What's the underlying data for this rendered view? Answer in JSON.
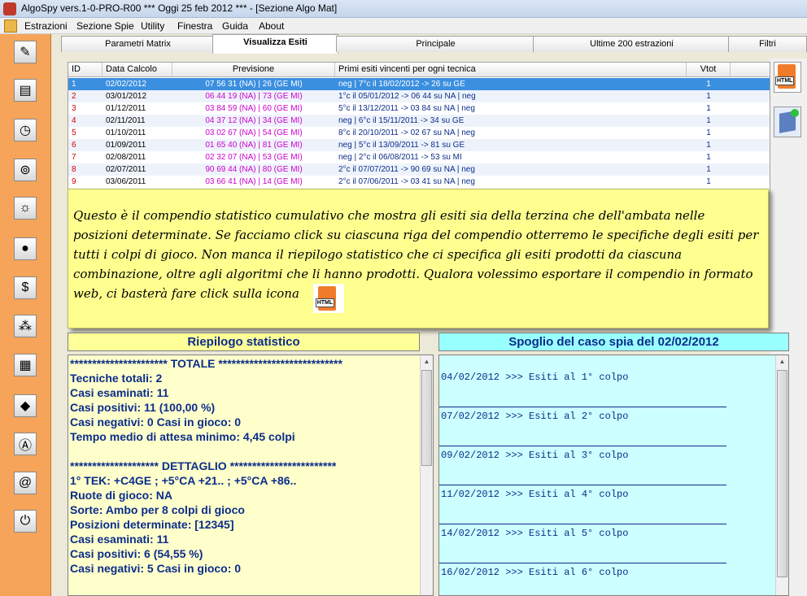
{
  "window": {
    "title": "AlgoSpy vers.1-0-PRO-R00  ***  Oggi 25 feb 2012  ***   - [Sezione Algo Mat]"
  },
  "menu": [
    "Estrazioni",
    "Sezione Spie",
    "Utility",
    "Finestra",
    "Guida",
    "About"
  ],
  "tabs": [
    "Parametri Matrix",
    "Visualizza Esiti",
    "Principale",
    "Ultime 200 estrazioni",
    "Filtri"
  ],
  "grid": {
    "headers": [
      "ID",
      "Data Calcolo",
      "Previsione",
      "Primi esiti vincenti per ogni tecnica",
      "Vtot"
    ],
    "rows": [
      {
        "id": "1",
        "data": "02/02/2012",
        "prev": "07 56 31 (NA) | 26 (GE MI)",
        "esiti": "neg | 7°c il 18/02/2012 -> 26 su GE",
        "vtot": "1"
      },
      {
        "id": "2",
        "data": "03/01/2012",
        "prev": "06 44 19 (NA) | 73 (GE MI)",
        "esiti": "1°c il 05/01/2012 -> 06 44 su NA | neg",
        "vtot": "1"
      },
      {
        "id": "3",
        "data": "01/12/2011",
        "prev": "03 84 59 (NA) | 60 (GE MI)",
        "esiti": "5°c il 13/12/2011 -> 03 84 su NA | neg",
        "vtot": "1"
      },
      {
        "id": "4",
        "data": "02/11/2011",
        "prev": "04 37 12 (NA) | 34 (GE MI)",
        "esiti": "neg | 6°c il 15/11/2011 -> 34 su GE",
        "vtot": "1"
      },
      {
        "id": "5",
        "data": "01/10/2011",
        "prev": "03 02 67 (NA) | 54 (GE MI)",
        "esiti": "8°c il 20/10/2011 -> 02 67 su NA | neg",
        "vtot": "1"
      },
      {
        "id": "6",
        "data": "01/09/2011",
        "prev": "01 65 40 (NA) | 81 (GE MI)",
        "esiti": "neg | 5°c il 13/09/2011 -> 81 su GE",
        "vtot": "1"
      },
      {
        "id": "7",
        "data": "02/08/2011",
        "prev": "02 32 07 (NA) | 53 (GE MI)",
        "esiti": "neg | 2°c il 06/08/2011 -> 53 su MI",
        "vtot": "1"
      },
      {
        "id": "8",
        "data": "02/07/2011",
        "prev": "90 69 44 (NA) | 80 (GE MI)",
        "esiti": "2°c il 07/07/2011 -> 90 69 su NA | neg",
        "vtot": "1"
      },
      {
        "id": "9",
        "data": "03/06/2011",
        "prev": "03 66 41 (NA) | 14 (GE MI)",
        "esiti": "2°c il 07/06/2011 -> 03 41 su NA | neg",
        "vtot": "1"
      }
    ]
  },
  "note": {
    "text": "Questo è il compendio statistico cumulativo che mostra gli esiti sia della terzina che dell'ambata nelle posizioni determinate. Se facciamo click su ciascuna riga del compendio otterremo le specifiche degli esiti per tutti i colpi di gioco. Non manca il riepilogo statistico che ci specifica gli esiti prodotti da ciascuna combinazione, oltre agli algoritmi che li hanno prodotti. Qualora volessimo esportare il compendio in formato web, ci basterà fare click sulla icona"
  },
  "icons": {
    "html_label": "HTML"
  },
  "riepilogo": {
    "title": "Riepilogo statistico",
    "lines": [
      "********************** TOTALE ****************************",
      "Tecniche totali: 2",
      "Casi esaminati: 11",
      "Casi positivi: 11 (100,00 %)",
      "Casi negativi: 0  Casi in gioco: 0",
      "Tempo medio di attesa minimo: 4,45 colpi",
      "",
      "******************** DETTAGLIO ************************",
      "1° TEK: +C4GE ; +5°CA +21.. ; +5°CA +86..",
      "Ruote di gioco: NA",
      "Sorte: Ambo per 8 colpi di gioco",
      "Posizioni determinate: [12345]",
      "Casi esaminati: 11",
      "Casi positivi: 6 (54,55 %)",
      "Casi negativi: 5  Casi in gioco: 0"
    ]
  },
  "spoglio": {
    "title": "Spoglio del caso spia del 02/02/2012",
    "lines": [
      "04/02/2012 >>> Esiti al 1° colpo",
      "07/02/2012 >>> Esiti al 2° colpo",
      "09/02/2012 >>> Esiti al 3° colpo",
      "11/02/2012 >>> Esiti al 4° colpo",
      "14/02/2012 >>> Esiti al 5° colpo",
      "16/02/2012 >>> Esiti al 6° colpo"
    ]
  }
}
